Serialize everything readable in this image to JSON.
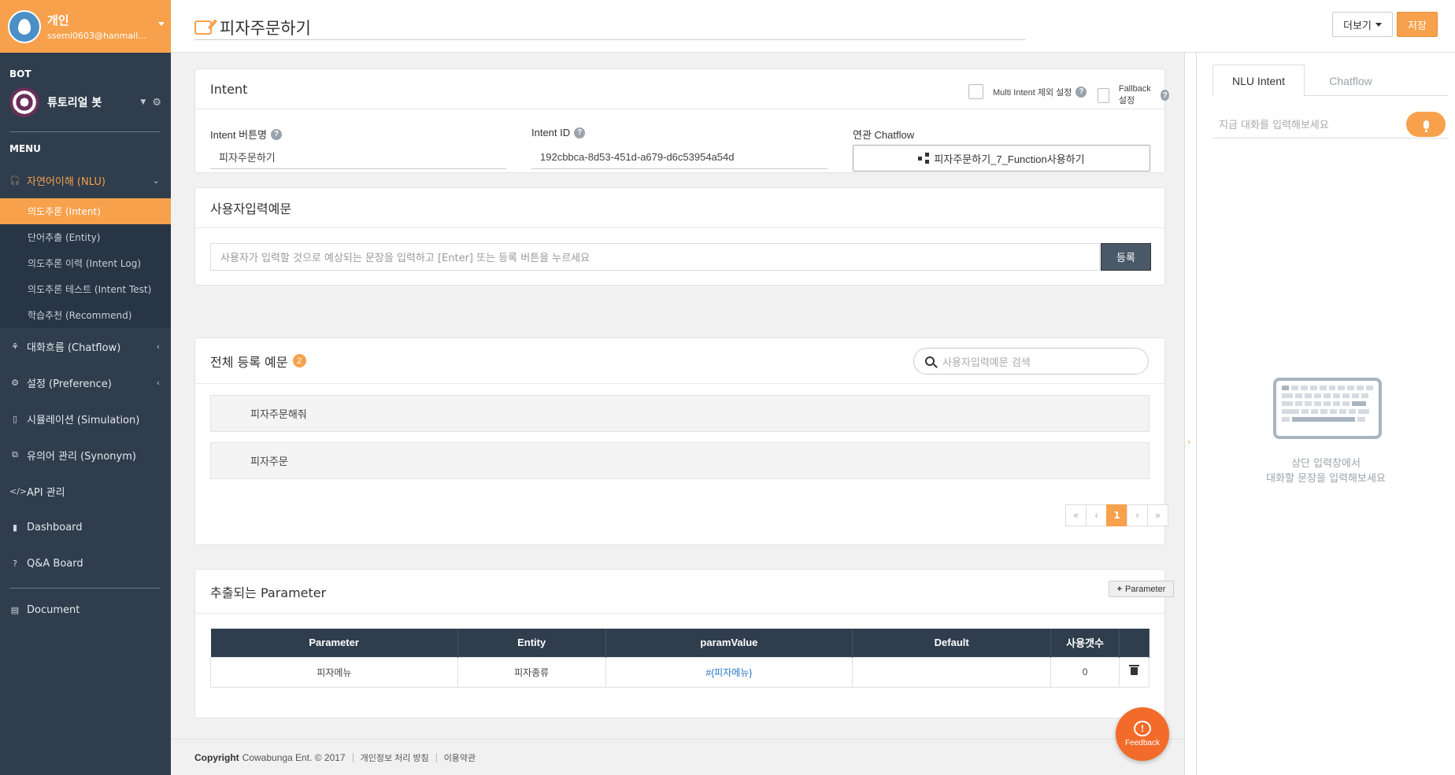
{
  "user": {
    "name": "개인",
    "email": "ssemi0603@hanmail..."
  },
  "sidebar": {
    "bot_section": "BOT",
    "bot_name": "튜토리얼 봇",
    "menu_section": "MENU",
    "nlu": {
      "label": "자연어이해 (NLU)",
      "items": [
        {
          "label": "의도추론 (Intent)",
          "active": true
        },
        {
          "label": "단어추출 (Entity)"
        },
        {
          "label": "의도추론 이력 (Intent Log)"
        },
        {
          "label": "의도추론 테스트 (Intent Test)"
        },
        {
          "label": "학습추천 (Recommend)"
        }
      ]
    },
    "items": [
      {
        "label": "대화흐름 (Chatflow)",
        "icon": "chatflow-icon"
      },
      {
        "label": "설정 (Preference)",
        "icon": "gears-icon"
      },
      {
        "label": "시뮬레이션 (Simulation)",
        "icon": "mobile-icon"
      },
      {
        "label": "유의어 관리 (Synonym)",
        "icon": "synonym-icon"
      },
      {
        "label": "API 관리",
        "icon": "code-icon"
      },
      {
        "label": "Dashboard",
        "icon": "bar-chart-icon"
      },
      {
        "label": "Q&A Board",
        "icon": "question-icon"
      }
    ],
    "document": "Document"
  },
  "header": {
    "title": "피자주문하기",
    "more_label": "더보기",
    "save_label": "저장"
  },
  "intent_card": {
    "title": "Intent",
    "multi_intent_label": "Multi Intent 제외 설정",
    "fallback_label": "Fallback 설정",
    "button_name_label": "Intent 버튼명",
    "button_name_value": "피자주문하기",
    "id_label": "Intent ID",
    "id_value": "192cbbca-8d53-451d-a679-d6c53954a54d",
    "chatflow_label": "연관 Chatflow",
    "chatflow_value": "피자주문하기_7_Function사용하기"
  },
  "utterance_card": {
    "title": "사용자입력예문",
    "placeholder": "사용자가 입력할 것으로 예상되는 문장을 입력하고 [Enter] 또는 등록 버튼을 누르세요",
    "register_label": "등록"
  },
  "all_utterances": {
    "title": "전체 등록 예문",
    "count": "2",
    "search_placeholder": "사용자입력예문 검색",
    "rows": [
      "피자주문해줘",
      "피자주문"
    ],
    "pager": {
      "first": "«",
      "prev": "‹",
      "current": "1",
      "next": "›",
      "last": "»"
    }
  },
  "parameter_card": {
    "title": "추출되는 Parameter",
    "add_label": "Parameter",
    "columns": [
      "Parameter",
      "Entity",
      "paramValue",
      "Default",
      "사용갯수",
      ""
    ],
    "rows": [
      {
        "parameter": "피자메뉴",
        "entity": "피자종류",
        "paramValue": "#{피자메뉴}",
        "default": "",
        "count": "0"
      }
    ]
  },
  "footer": {
    "copyright_label": "Copyright",
    "company": "Cowabunga Ent. © 2017",
    "privacy": "개인정보 처리 방침",
    "terms": "이용약관"
  },
  "feedback": {
    "label": "Feedback"
  },
  "right_panel": {
    "tabs": [
      "NLU Intent",
      "Chatflow"
    ],
    "input_placeholder": "지금 대화를 입력해보세요",
    "empty_line1": "상단 입력창에서",
    "empty_line2": "대화할 문장을 입력해보세요"
  },
  "colors": {
    "accent": "#f7a14c",
    "sidebar": "#2f3d4d",
    "link": "#1f76c9"
  }
}
